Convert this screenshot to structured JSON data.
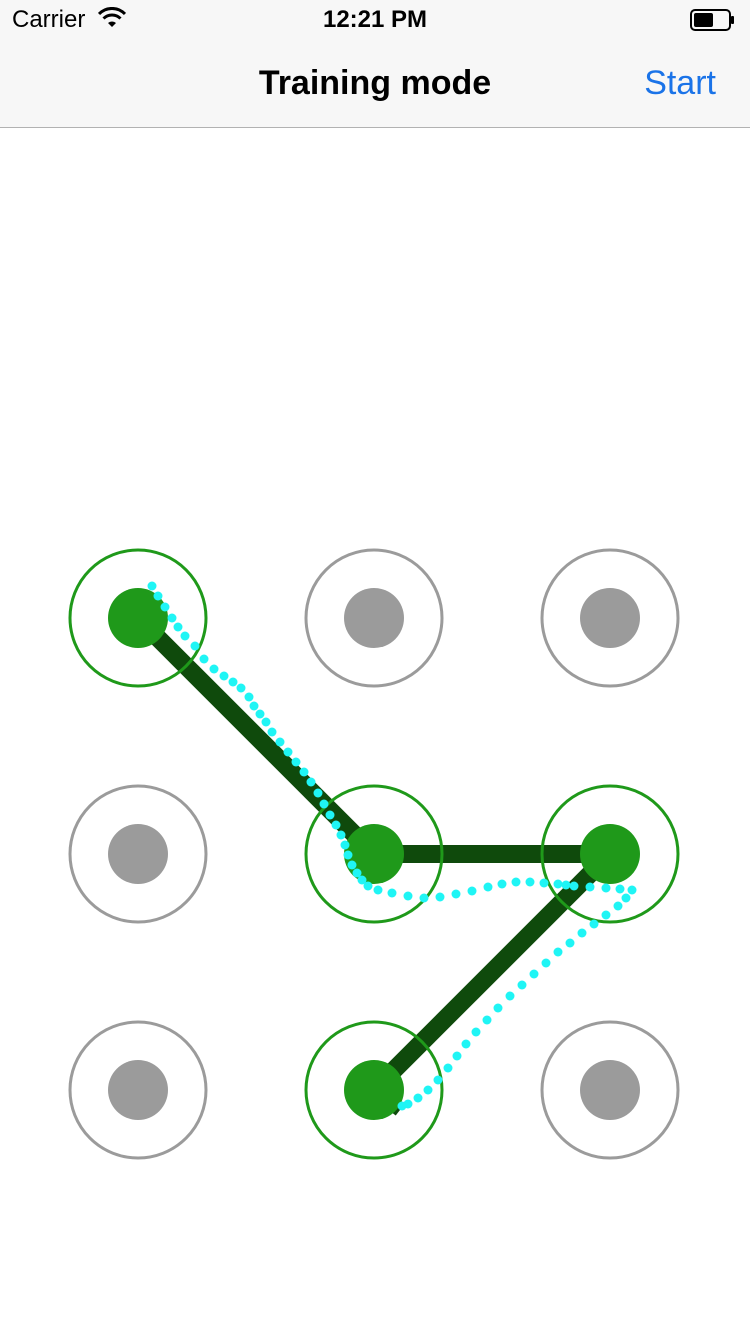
{
  "status_bar": {
    "carrier": "Carrier",
    "time": "12:21 PM",
    "wifi_icon": "wifi-icon",
    "battery_icon": "battery-icon"
  },
  "nav": {
    "title": "Training mode",
    "start_label": "Start"
  },
  "pattern": {
    "grid_size": 3,
    "selected_nodes": [
      0,
      4,
      5,
      7
    ],
    "path_order": [
      0,
      4,
      5,
      7
    ],
    "colors": {
      "active_ring": "#1f991a",
      "active_dot": "#1f991a",
      "inactive_ring": "#9b9b9b",
      "inactive_dot": "#9b9b9b",
      "path_line": "#0f4a0c",
      "touch_trace": "#1ff5f5"
    }
  }
}
